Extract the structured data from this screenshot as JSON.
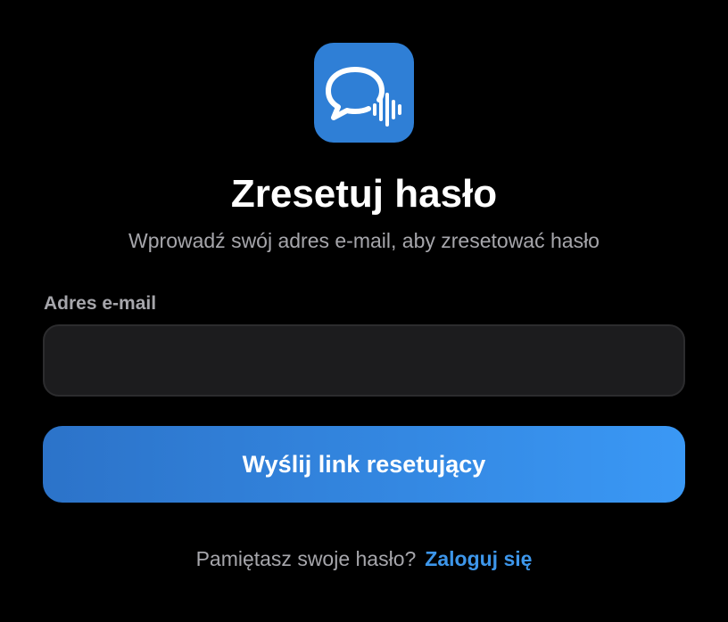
{
  "app": {
    "icon": "chat-bubble-soundwave-icon",
    "icon_color": "#2f7fd6"
  },
  "header": {
    "title": "Zresetuj hasło",
    "subtitle": "Wprowadź swój adres e-mail, aby zresetować hasło"
  },
  "form": {
    "email_label": "Adres e-mail",
    "email_value": "",
    "email_placeholder": "",
    "submit_label": "Wyślij link resetujący"
  },
  "footer": {
    "prompt": "Pamiętasz swoje hasło?",
    "login_link": "Zaloguj się"
  },
  "colors": {
    "background": "#000000",
    "accent": "#3a98f5",
    "link": "#3d96ea",
    "muted_text": "#a6a6ab",
    "input_bg": "#1c1c1e"
  }
}
